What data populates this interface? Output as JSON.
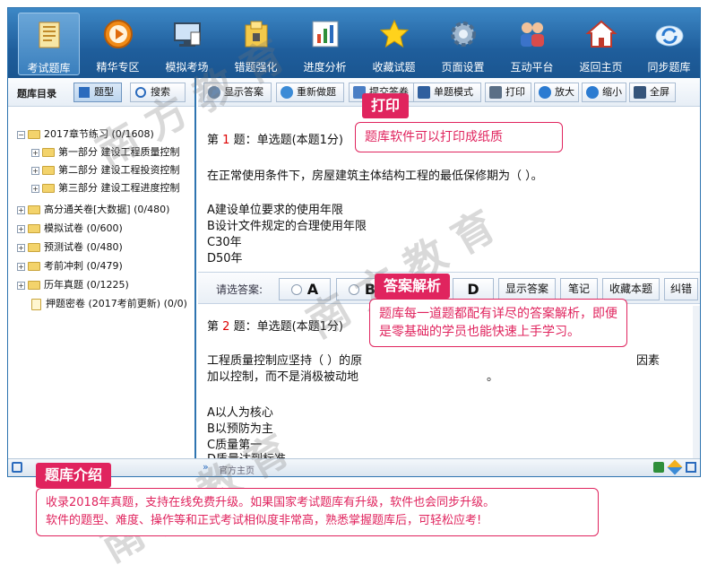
{
  "nav": [
    {
      "label": "考试题库",
      "icon": "book-icon",
      "active": true
    },
    {
      "label": "精华专区",
      "icon": "play-disc-icon",
      "active": false
    },
    {
      "label": "模拟考场",
      "icon": "monitor-icon",
      "active": false
    },
    {
      "label": "错题强化",
      "icon": "lock-folder-icon",
      "active": false
    },
    {
      "label": "进度分析",
      "icon": "bar-chart-icon",
      "active": false
    },
    {
      "label": "收藏试题",
      "icon": "star-icon",
      "active": false
    },
    {
      "label": "页面设置",
      "icon": "gear-icon",
      "active": false
    },
    {
      "label": "互动平台",
      "icon": "users-icon",
      "active": false
    },
    {
      "label": "返回主页",
      "icon": "home-icon",
      "active": false
    },
    {
      "label": "同步题库",
      "icon": "sync-icon",
      "active": false
    }
  ],
  "left": {
    "title": "题库目录",
    "tab_tixing": "题型",
    "tab_search": "搜索"
  },
  "tree": [
    {
      "label": "2017章节练习 (0/1608)",
      "level": 0,
      "pm": "−"
    },
    {
      "label": "第一部分  建设工程质量控制",
      "level": 1,
      "pm": "+"
    },
    {
      "label": "第二部分  建设工程投资控制",
      "level": 1,
      "pm": "+"
    },
    {
      "label": "第三部分  建设工程进度控制",
      "level": 1,
      "pm": "+"
    },
    {
      "label": "高分通关卷[大数据] (0/480)",
      "level": 0,
      "pm": "+"
    },
    {
      "label": "模拟试卷 (0/600)",
      "level": 0,
      "pm": "+"
    },
    {
      "label": "预测试卷 (0/480)",
      "level": 0,
      "pm": "+"
    },
    {
      "label": "考前冲刺 (0/479)",
      "level": 0,
      "pm": "+"
    },
    {
      "label": "历年真题 (0/1225)",
      "level": 0,
      "pm": "+"
    },
    {
      "label": "押题密卷 (2017考前更新) (0/0)",
      "level": 1,
      "pm": ""
    }
  ],
  "toolbar": {
    "show_answer": "显示答案",
    "redo": "重新做题",
    "submit": "提交答卷",
    "single_mode": "单题模式",
    "print": "打印",
    "zoom_in": "放大",
    "zoom_out": "缩小",
    "fullscreen": "全屏"
  },
  "q1": {
    "prefix": "第",
    "num": "1",
    "suffix": "题：单选题(本题1分)",
    "stem": "在正常使用条件下，房屋建筑主体结构工程的最低保修期为（ ）。",
    "options": [
      "A建设单位要求的使用年限",
      "B设计文件规定的合理使用年限",
      "C30年",
      "D50年"
    ]
  },
  "answer_bar": {
    "label": "请选答案:",
    "opt_a": "A",
    "opt_b": "B",
    "opt_d": "D",
    "show_answer": "显示答案",
    "note": "笔记",
    "favorite": "收藏本题",
    "correct": "纠错"
  },
  "q2": {
    "prefix": "第",
    "num": "2",
    "suffix": "题：单选题(本题1分)",
    "stem_line1": "工程质量控制应坚持（ ）的原",
    "stem_line1_end": "因素",
    "stem_line2": "加以控制，而不是消极被动地",
    "stem_line2_end": "。",
    "options": [
      "A以人为核心",
      "B以预防为主",
      "C质量第一",
      "D质量达到标准"
    ]
  },
  "status": {
    "text": "官方主页"
  },
  "callouts": {
    "print_tag": "打印",
    "print_text": "题库软件可以打印成纸质",
    "analysis_tag": "答案解析",
    "analysis_text": "题库每一道题都配有详尽的答案解析，即便是零基础的学员也能快速上手学习。",
    "intro_tag": "题库介绍",
    "intro_line1": "收录2018年真题，支持在线免费升级。如果国家考试题库有升级，软件也会同步升级。",
    "intro_line2": "软件的题型、难度、操作等和正式考试相似度非常高，熟悉掌握题库后，可轻松应考!"
  },
  "colors": {
    "accent": "#e0245e",
    "frame": "#2e74b0",
    "question_number": "#dd0000"
  }
}
